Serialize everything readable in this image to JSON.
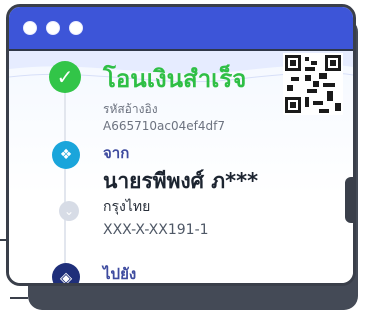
{
  "window": {
    "controls": [
      "close",
      "minimize",
      "maximize"
    ]
  },
  "status": {
    "title": "โอนเงินสำเร็จ"
  },
  "reference": {
    "label": "รหัสอ้างอิง",
    "id": "A665710ac04ef4df7"
  },
  "from": {
    "label": "จาก",
    "name": "นายรพีพงศ์ ภ***",
    "bank": "กรุงไทย",
    "account": "XXX-X-XX191-1"
  },
  "to": {
    "label": "ไปยัง"
  },
  "colors": {
    "accent": "#3d55d8",
    "success": "#32c548",
    "bank_from_icon": "#1aa5db",
    "bank_to_icon": "#1f2f7a"
  },
  "icons": {
    "success": "check-circle-icon",
    "qr": "qr-code-icon",
    "from_bank": "bank-logo-icon",
    "bank_branch": "bank-secondary-icon",
    "to_bank": "bank-logo-icon"
  }
}
